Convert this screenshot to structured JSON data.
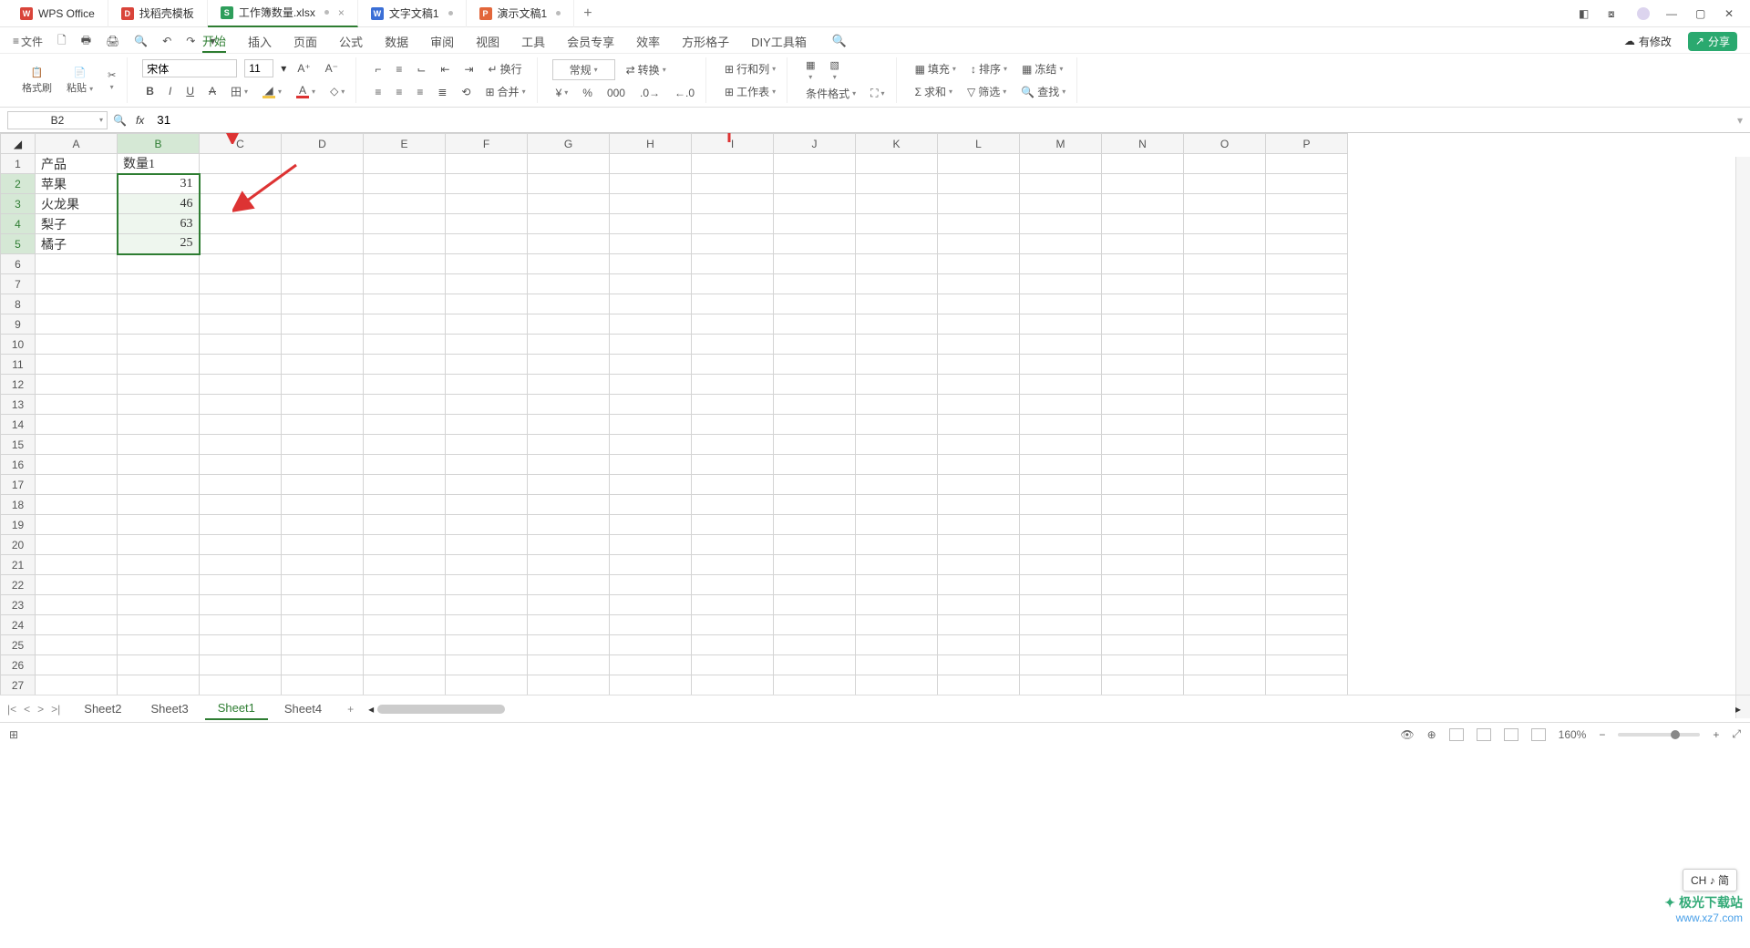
{
  "titlebar": {
    "app_tab": {
      "label": "WPS Office",
      "color": "#d9443a"
    },
    "tabs": [
      {
        "icon": "D",
        "color": "#d9443a",
        "label": "找稻壳模板"
      },
      {
        "icon": "S",
        "color": "#2e9e5b",
        "label": "工作簿数量.xlsx",
        "dirty": true,
        "active": true,
        "has_close": true
      },
      {
        "icon": "W",
        "color": "#3b6fd6",
        "label": "文字文稿1",
        "dirty": true
      },
      {
        "icon": "P",
        "color": "#e2663a",
        "label": "演示文稿1",
        "dirty": true
      }
    ],
    "add": "+"
  },
  "quickaccess": {
    "file_label": "文件"
  },
  "menubar": {
    "items": [
      "开始",
      "插入",
      "页面",
      "公式",
      "数据",
      "审阅",
      "视图",
      "工具",
      "会员专享",
      "效率",
      "方形格子",
      "DIY工具箱"
    ],
    "active": 0
  },
  "filerow_right": {
    "has_changes": "有修改",
    "share": "分享"
  },
  "ribbon": {
    "format_painter": "格式刷",
    "paste": "粘贴",
    "font_name": "宋体",
    "font_size": "11",
    "wrap": "换行",
    "general": "常规",
    "convert": "转换",
    "rowcol": "行和列",
    "worksheet": "工作表",
    "cond_format": "条件格式",
    "fill": "填充",
    "sort": "排序",
    "freeze": "冻结",
    "sum": "求和",
    "filter": "筛选",
    "find": "查找",
    "merge_center": "合并"
  },
  "formulabar": {
    "namebox": "B2",
    "fx": "fx",
    "value": "31"
  },
  "grid": {
    "columns": [
      "A",
      "B",
      "C",
      "D",
      "E",
      "F",
      "G",
      "H",
      "I",
      "J",
      "K",
      "L",
      "M",
      "N",
      "O",
      "P"
    ],
    "row_count": 27,
    "col_widths": {
      "default": 90,
      "A": 90,
      "B": 90
    },
    "selected_col": "B",
    "selected_rows": [
      2,
      3,
      4,
      5
    ],
    "active_cell": "B2",
    "data": {
      "A1": "产品",
      "B1": "数量1",
      "A2": "苹果",
      "B2": "31",
      "A3": "火龙果",
      "B3": "46",
      "A4": "梨子",
      "B4": "63",
      "A5": "橘子",
      "B5": "25"
    }
  },
  "sheetbar": {
    "tabs": [
      "Sheet2",
      "Sheet3",
      "Sheet1",
      "Sheet4"
    ],
    "active": 2,
    "add": "+"
  },
  "statusbar": {
    "zoom": "160%",
    "ime": "CH ♪ 简"
  },
  "watermark": {
    "brand": "极光下载站",
    "url": "www.xz7.com"
  }
}
